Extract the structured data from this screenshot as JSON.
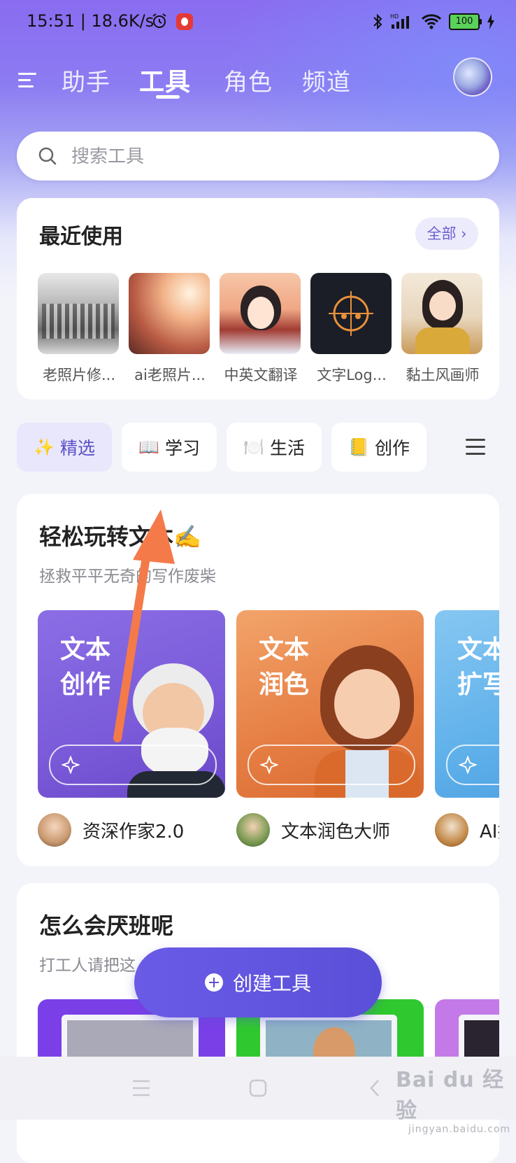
{
  "status_bar": {
    "time_speed": "15:51 | 18.6K/s",
    "battery": "100"
  },
  "nav": {
    "tabs": [
      "助手",
      "工具",
      "角色",
      "频道"
    ],
    "active_tab": "工具"
  },
  "search": {
    "placeholder": "搜索工具"
  },
  "recent": {
    "title": "最近使用",
    "all_label": "全部 ›",
    "items": [
      {
        "label": "老照片修..."
      },
      {
        "label": "ai老照片..."
      },
      {
        "label": "中英文翻译"
      },
      {
        "label": "文字Log..."
      },
      {
        "label": "黏土风画师"
      }
    ]
  },
  "categories": [
    {
      "emoji": "✨",
      "label": "精选"
    },
    {
      "emoji": "📖",
      "label": "学习"
    },
    {
      "emoji": "🍽️",
      "label": "生活"
    },
    {
      "emoji": "📒",
      "label": "创作"
    }
  ],
  "section1": {
    "title": "轻松玩转文本✍️",
    "subtitle": "拯救平平无奇的写作废柴",
    "cards": [
      {
        "text": "文本\n创作",
        "owner": "资深作家2.0"
      },
      {
        "text": "文本\n润色",
        "owner": "文本润色大师"
      },
      {
        "text": "文本\n扩写",
        "owner": "AI扩写"
      }
    ]
  },
  "section2": {
    "title": "怎么会厌班呢",
    "subtitle": "打工人请把这"
  },
  "fab": {
    "label": "创建工具"
  },
  "watermark": {
    "brand": "Bai du 经验",
    "site": "jingyan.baidu.com"
  },
  "colors": {
    "accent": "#5a4fd8",
    "arrow": "#f47a4a"
  }
}
